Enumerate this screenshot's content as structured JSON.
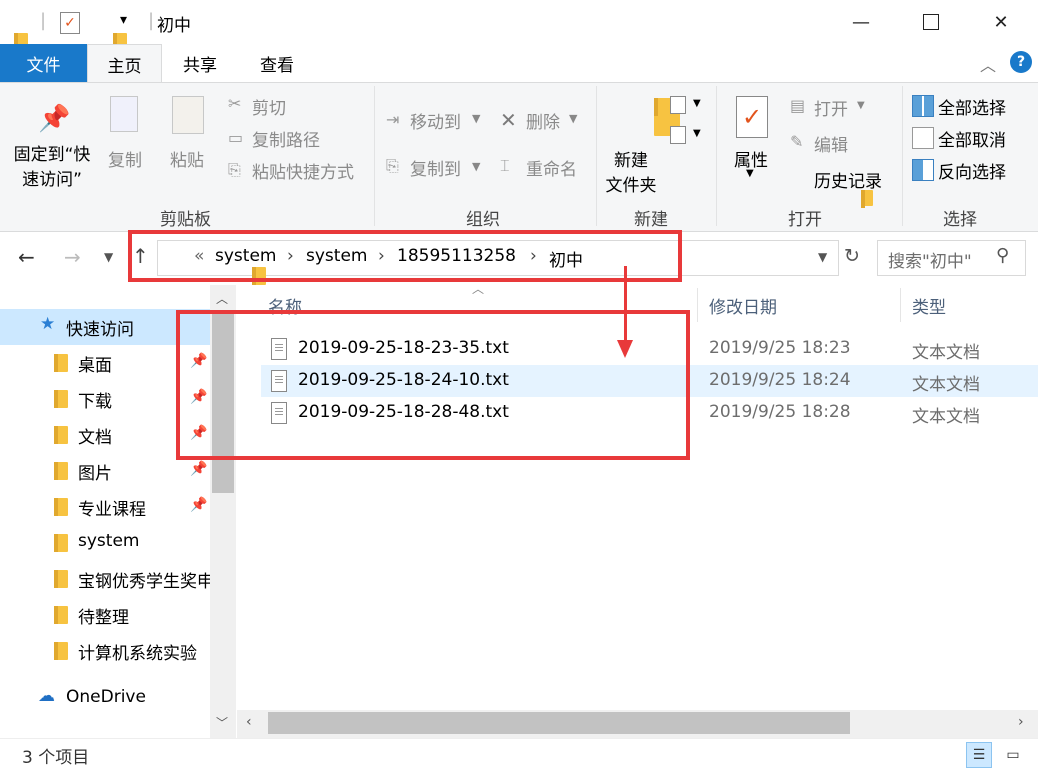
{
  "title": "初中",
  "tabs": {
    "file": "文件",
    "home": "主页",
    "share": "共享",
    "view": "查看"
  },
  "ribbon": {
    "pin_quick_access_line1": "固定到“快",
    "pin_quick_access_line2": "速访问”",
    "copy": "复制",
    "paste": "粘贴",
    "cut": "剪切",
    "copy_path": "复制路径",
    "paste_shortcut": "粘贴快捷方式",
    "clipboard_group": "剪贴板",
    "move_to": "移动到",
    "copy_to": "复制到",
    "delete": "删除",
    "rename": "重命名",
    "organize_group": "组织",
    "new_folder_line1": "新建",
    "new_folder_line2": "文件夹",
    "new_group": "新建",
    "properties": "属性",
    "open": "打开",
    "edit": "编辑",
    "history": "历史记录",
    "open_group": "打开",
    "select_all": "全部选择",
    "select_none": "全部取消",
    "invert_selection": "反向选择",
    "select_group": "选择"
  },
  "address": {
    "overflow": "«",
    "crumbs": [
      "system",
      "system",
      "18595113258",
      "初中"
    ]
  },
  "search": {
    "placeholder": "搜索\"初中\""
  },
  "nav": {
    "quick_access": "快速访问",
    "items": [
      "桌面",
      "下载",
      "文档",
      "图片",
      "专业课程",
      "system",
      "宝钢优秀学生奖申",
      "待整理",
      "计算机系统实验"
    ],
    "onedrive": "OneDrive"
  },
  "columns": {
    "name": "名称",
    "modified": "修改日期",
    "type": "类型"
  },
  "files": [
    {
      "name": "2019-09-25-18-23-35.txt",
      "modified": "2019/9/25 18:23",
      "type": "文本文档"
    },
    {
      "name": "2019-09-25-18-24-10.txt",
      "modified": "2019/9/25 18:24",
      "type": "文本文档"
    },
    {
      "name": "2019-09-25-18-28-48.txt",
      "modified": "2019/9/25 18:28",
      "type": "文本文档"
    }
  ],
  "status": {
    "count": "3 个项目"
  },
  "colors": {
    "accent": "#1979ca",
    "highlight": "#e8393a",
    "selected_row": "#e5f3ff"
  }
}
